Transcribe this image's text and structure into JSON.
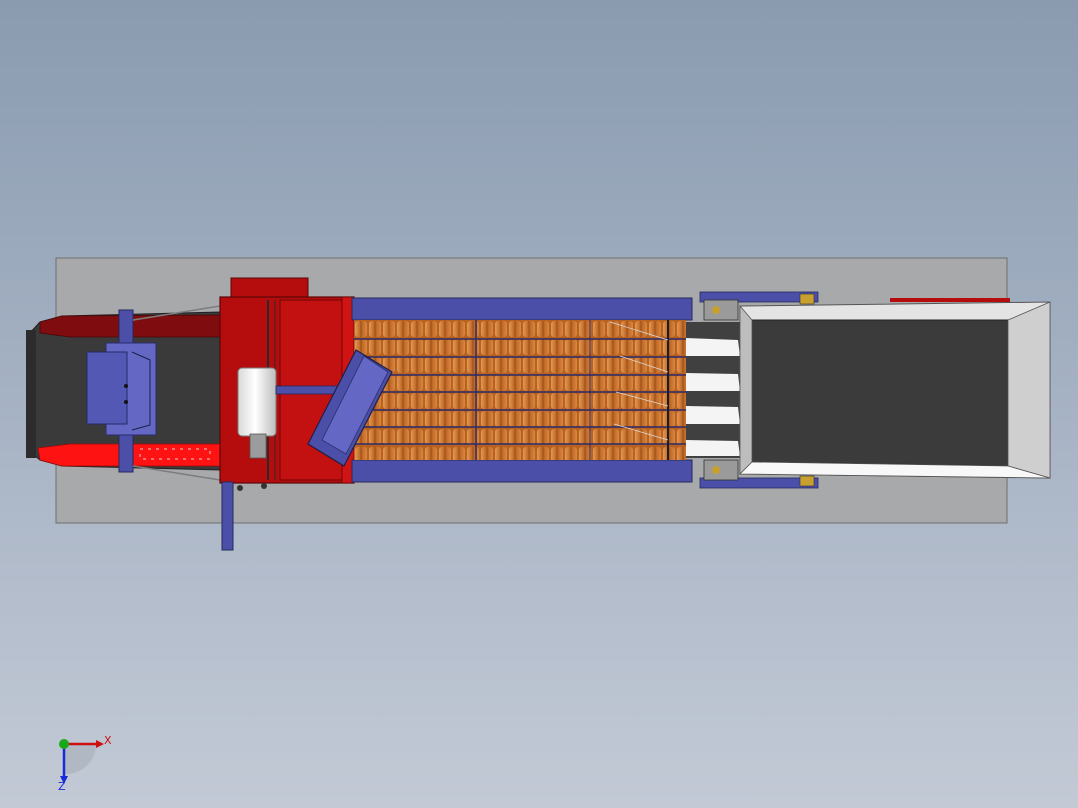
{
  "viewport": {
    "background_top": "#8a9bb0",
    "background_bottom": "#c3cad6"
  },
  "model": {
    "colors": {
      "base_plate": "#a8a9ab",
      "frame_red": "#b50d0d",
      "bright_red": "#ff1010",
      "frame_blue": "#4b4fa8",
      "dark_belt": "#3b3b3b",
      "orange_rollers": "#c7702a",
      "hopper_light": "#e4e4e4"
    }
  },
  "triad": {
    "x_label": "X",
    "z_label": "Z",
    "x_color": "#cc1010",
    "y_color": "#1aa81a",
    "z_color": "#1a2bd6",
    "icons": [
      "x-axis-arrow-icon",
      "z-axis-arrow-icon",
      "origin-sphere-icon"
    ]
  }
}
